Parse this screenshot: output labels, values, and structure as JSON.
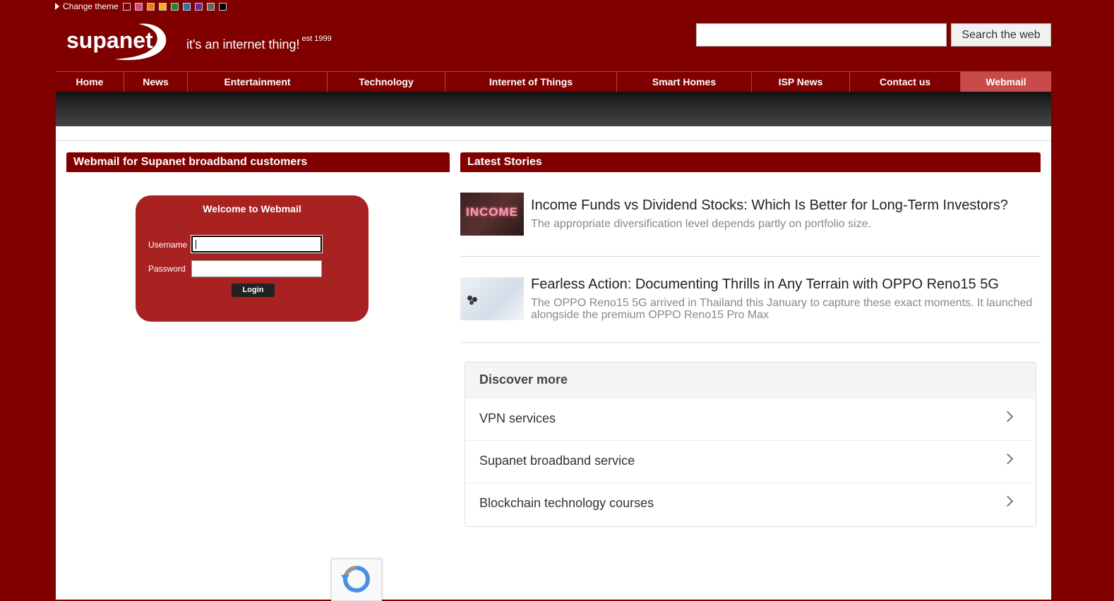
{
  "theme_bar": {
    "label": "Change theme",
    "swatches": [
      "#800000",
      "#e83e8c",
      "#f07a1a",
      "#f0b020",
      "#1e8a2e",
      "#2a72b0",
      "#6a2a9a",
      "#666666",
      "#000000"
    ]
  },
  "header": {
    "logo_text": "supanet",
    "tagline": "it's an internet thing!",
    "tagline_sup": "est 1999",
    "search_value": "",
    "search_button": "Search the web"
  },
  "nav": {
    "items": [
      {
        "label": "Home"
      },
      {
        "label": "News"
      },
      {
        "label": "Entertainment"
      },
      {
        "label": "Technology"
      },
      {
        "label": "Internet of Things"
      },
      {
        "label": "Smart Homes"
      },
      {
        "label": "ISP News"
      },
      {
        "label": "Contact us"
      },
      {
        "label": "Webmail"
      }
    ],
    "active": "Webmail"
  },
  "webmail": {
    "section_title": "Webmail for Supanet broadband customers",
    "box_title": "Welcome to Webmail",
    "username_label": "Username",
    "password_label": "Password",
    "username_value": "",
    "password_value": "",
    "login_button": "Login"
  },
  "stories": {
    "section_title": "Latest Stories",
    "items": [
      {
        "image_text": "INCOME",
        "title": "Income Funds vs Dividend Stocks: Which Is Better for Long-Term Investors?",
        "desc": "The appropriate diversification level depends partly on portfolio size."
      },
      {
        "image_text": "",
        "title": "Fearless Action: Documenting Thrills in Any Terrain with OPPO Reno15 5G",
        "desc": "The OPPO Reno15 5G arrived in Thailand this January to capture these exact moments. It launched alongside the premium OPPO Reno15 Pro Max"
      }
    ]
  },
  "discover": {
    "title": "Discover more",
    "items": [
      {
        "label": "VPN services"
      },
      {
        "label": "Supanet broadband service"
      },
      {
        "label": "Blockchain technology courses"
      }
    ]
  },
  "colors": {
    "brand": "#800000",
    "login_box": "#a82222",
    "nav_active": "#c94a4a"
  }
}
